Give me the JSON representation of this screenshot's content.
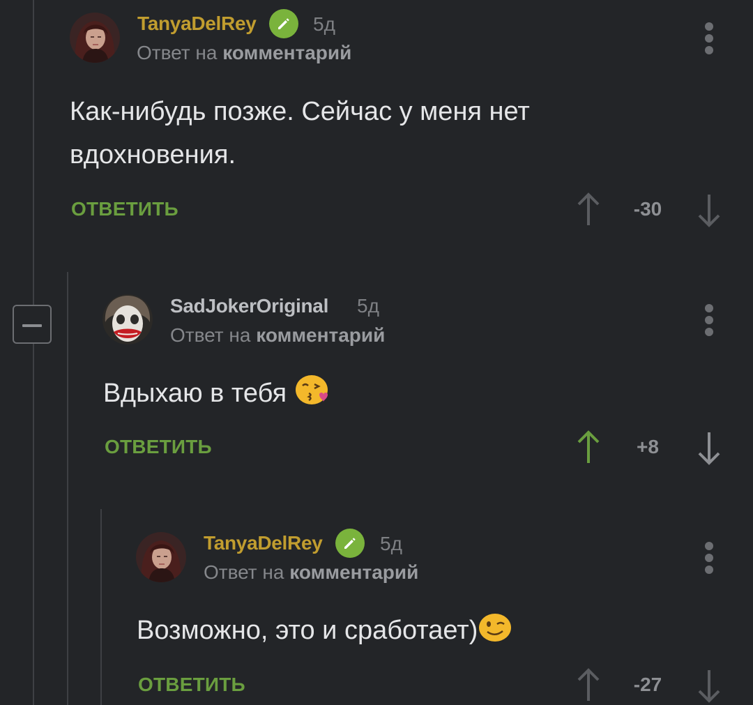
{
  "colors": {
    "background": "#232528",
    "author_gold": "#c19d2f",
    "reply_green": "#6a9e3f",
    "upvote_active": "#6a9e3f",
    "vote_inactive": "#5b5d61"
  },
  "comments": [
    {
      "author": "TanyaDelRey",
      "time": "5д",
      "reply_prefix": "Ответ на",
      "reply_target": "комментарий",
      "text": "Как-нибудь позже. Сейчас у меня нет вдохновения.",
      "reply_label": "ОТВЕТИТЬ",
      "rating": "-30",
      "upvoted": false
    },
    {
      "author": "SadJokerOriginal",
      "time": "5д",
      "reply_prefix": "Ответ на",
      "reply_target": "комментарий",
      "text": "Вдыхаю в тебя",
      "emoji": "kissing-face-emoji",
      "reply_label": "ОТВЕТИТЬ",
      "rating": "+8",
      "upvoted": true
    },
    {
      "author": "TanyaDelRey",
      "time": "5д",
      "reply_prefix": "Ответ на",
      "reply_target": "комментарий",
      "text": "Возможно, это и сработает)",
      "emoji": "winking-face-emoji",
      "reply_label": "ОТВЕТИТЬ",
      "rating": "-27",
      "upvoted": false
    }
  ],
  "icons": {
    "edit_badge": "pencil-icon",
    "more": "kebab-menu-icon",
    "upvote": "arrow-up-icon",
    "downvote": "arrow-down-icon",
    "collapse": "minus-icon"
  }
}
